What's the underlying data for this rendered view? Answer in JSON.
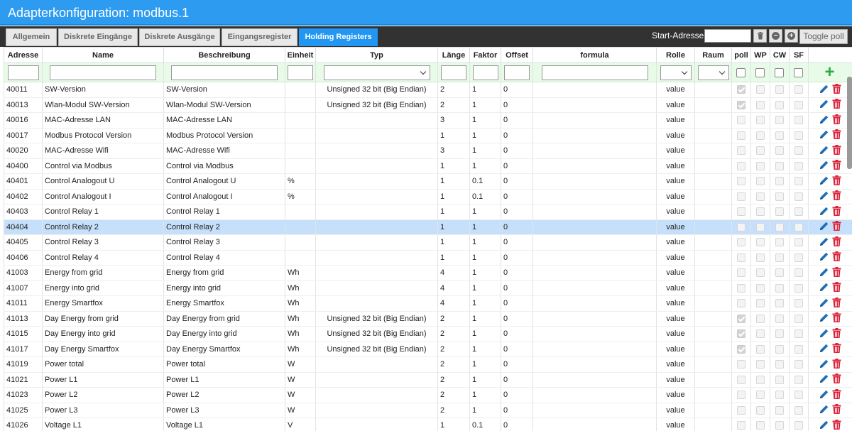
{
  "title": "Adapterkonfiguration: modbus.1",
  "tabs": [
    "Allgemein",
    "Diskrete Eingänge",
    "Diskrete Ausgänge",
    "Eingangsregister",
    "Holding Registers"
  ],
  "toolbar": {
    "start_label": "Start-Adresse:",
    "toggle_label": "Toggle poll"
  },
  "columns": [
    "Adresse",
    "Name",
    "Beschreibung",
    "Einheit",
    "Typ",
    "Länge",
    "Faktor",
    "Offset",
    "formula",
    "Rolle",
    "Raum",
    "poll",
    "WP",
    "CW",
    "SF"
  ],
  "rows": [
    {
      "adresse": "40011",
      "name": "SW-Version",
      "beschreibung": "SW-Version",
      "einheit": "",
      "typ": "Unsigned 32 bit (Big Endian)",
      "laenge": "2",
      "faktor": "1",
      "offset": "0",
      "formula": "",
      "rolle": "value",
      "raum": "",
      "poll": true
    },
    {
      "adresse": "40013",
      "name": "Wlan-Modul SW-Version",
      "beschreibung": "Wlan-Modul SW-Version",
      "einheit": "",
      "typ": "Unsigned 32 bit (Big Endian)",
      "laenge": "2",
      "faktor": "1",
      "offset": "0",
      "formula": "",
      "rolle": "value",
      "raum": "",
      "poll": true
    },
    {
      "adresse": "40016",
      "name": "MAC-Adresse LAN",
      "beschreibung": "MAC-Adresse LAN",
      "einheit": "",
      "typ": "",
      "laenge": "3",
      "faktor": "1",
      "offset": "0",
      "formula": "",
      "rolle": "value",
      "raum": "",
      "poll": false
    },
    {
      "adresse": "40017",
      "name": "Modbus Protocol Version",
      "beschreibung": "Modbus Protocol Version",
      "einheit": "",
      "typ": "",
      "laenge": "1",
      "faktor": "1",
      "offset": "0",
      "formula": "",
      "rolle": "value",
      "raum": "",
      "poll": false
    },
    {
      "adresse": "40020",
      "name": "MAC-Adresse Wifi",
      "beschreibung": "MAC-Adresse Wifi",
      "einheit": "",
      "typ": "",
      "laenge": "3",
      "faktor": "1",
      "offset": "0",
      "formula": "",
      "rolle": "value",
      "raum": "",
      "poll": false
    },
    {
      "adresse": "40400",
      "name": "Control via Modbus",
      "beschreibung": "Control via Modbus",
      "einheit": "",
      "typ": "",
      "laenge": "1",
      "faktor": "1",
      "offset": "0",
      "formula": "",
      "rolle": "value",
      "raum": "",
      "poll": false
    },
    {
      "adresse": "40401",
      "name": "Control Analogout U",
      "beschreibung": "Control Analogout U",
      "einheit": "%",
      "typ": "",
      "laenge": "1",
      "faktor": "0.1",
      "offset": "0",
      "formula": "",
      "rolle": "value",
      "raum": "",
      "poll": false
    },
    {
      "adresse": "40402",
      "name": "Control Analogout I",
      "beschreibung": "Control Analogout I",
      "einheit": "%",
      "typ": "",
      "laenge": "1",
      "faktor": "0.1",
      "offset": "0",
      "formula": "",
      "rolle": "value",
      "raum": "",
      "poll": false
    },
    {
      "adresse": "40403",
      "name": "Control Relay 1",
      "beschreibung": "Control Relay 1",
      "einheit": "",
      "typ": "",
      "laenge": "1",
      "faktor": "1",
      "offset": "0",
      "formula": "",
      "rolle": "value",
      "raum": "",
      "poll": false
    },
    {
      "adresse": "40404",
      "name": "Control Relay 2",
      "beschreibung": "Control Relay 2",
      "einheit": "",
      "typ": "",
      "laenge": "1",
      "faktor": "1",
      "offset": "0",
      "formula": "",
      "rolle": "value",
      "raum": "",
      "poll": false,
      "selected": true
    },
    {
      "adresse": "40405",
      "name": "Control Relay 3",
      "beschreibung": "Control Relay 3",
      "einheit": "",
      "typ": "",
      "laenge": "1",
      "faktor": "1",
      "offset": "0",
      "formula": "",
      "rolle": "value",
      "raum": "",
      "poll": false
    },
    {
      "adresse": "40406",
      "name": "Control Relay 4",
      "beschreibung": "Control Relay 4",
      "einheit": "",
      "typ": "",
      "laenge": "1",
      "faktor": "1",
      "offset": "0",
      "formula": "",
      "rolle": "value",
      "raum": "",
      "poll": false
    },
    {
      "adresse": "41003",
      "name": "Energy from grid",
      "beschreibung": "Energy from grid",
      "einheit": "Wh",
      "typ": "",
      "laenge": "4",
      "faktor": "1",
      "offset": "0",
      "formula": "",
      "rolle": "value",
      "raum": "",
      "poll": false
    },
    {
      "adresse": "41007",
      "name": "Energy into grid",
      "beschreibung": "Energy into grid",
      "einheit": "Wh",
      "typ": "",
      "laenge": "4",
      "faktor": "1",
      "offset": "0",
      "formula": "",
      "rolle": "value",
      "raum": "",
      "poll": false
    },
    {
      "adresse": "41011",
      "name": "Energy Smartfox",
      "beschreibung": "Energy Smartfox",
      "einheit": "Wh",
      "typ": "",
      "laenge": "4",
      "faktor": "1",
      "offset": "0",
      "formula": "",
      "rolle": "value",
      "raum": "",
      "poll": false
    },
    {
      "adresse": "41013",
      "name": "Day Energy from grid",
      "beschreibung": "Day Energy from grid",
      "einheit": "Wh",
      "typ": "Unsigned 32 bit (Big Endian)",
      "laenge": "2",
      "faktor": "1",
      "offset": "0",
      "formula": "",
      "rolle": "value",
      "raum": "",
      "poll": true
    },
    {
      "adresse": "41015",
      "name": "Day Energy into grid",
      "beschreibung": "Day Energy into grid",
      "einheit": "Wh",
      "typ": "Unsigned 32 bit (Big Endian)",
      "laenge": "2",
      "faktor": "1",
      "offset": "0",
      "formula": "",
      "rolle": "value",
      "raum": "",
      "poll": true
    },
    {
      "adresse": "41017",
      "name": "Day Energy Smartfox",
      "beschreibung": "Day Energy Smartfox",
      "einheit": "Wh",
      "typ": "Unsigned 32 bit (Big Endian)",
      "laenge": "2",
      "faktor": "1",
      "offset": "0",
      "formula": "",
      "rolle": "value",
      "raum": "",
      "poll": true
    },
    {
      "adresse": "41019",
      "name": "Power total",
      "beschreibung": "Power total",
      "einheit": "W",
      "typ": "",
      "laenge": "2",
      "faktor": "1",
      "offset": "0",
      "formula": "",
      "rolle": "value",
      "raum": "",
      "poll": false
    },
    {
      "adresse": "41021",
      "name": "Power L1",
      "beschreibung": "Power L1",
      "einheit": "W",
      "typ": "",
      "laenge": "2",
      "faktor": "1",
      "offset": "0",
      "formula": "",
      "rolle": "value",
      "raum": "",
      "poll": false
    },
    {
      "adresse": "41023",
      "name": "Power L2",
      "beschreibung": "Power L2",
      "einheit": "W",
      "typ": "",
      "laenge": "2",
      "faktor": "1",
      "offset": "0",
      "formula": "",
      "rolle": "value",
      "raum": "",
      "poll": false
    },
    {
      "adresse": "41025",
      "name": "Power L3",
      "beschreibung": "Power L3",
      "einheit": "W",
      "typ": "",
      "laenge": "2",
      "faktor": "1",
      "offset": "0",
      "formula": "",
      "rolle": "value",
      "raum": "",
      "poll": false
    },
    {
      "adresse": "41026",
      "name": "Voltage L1",
      "beschreibung": "Voltage L1",
      "einheit": "V",
      "typ": "",
      "laenge": "1",
      "faktor": "0.1",
      "offset": "0",
      "formula": "",
      "rolle": "value",
      "raum": "",
      "poll": false
    }
  ],
  "icons": {
    "trash": "trash-icon",
    "remove": "minus-circle-icon",
    "add_one": "plus-circle-icon",
    "add_row": "plus-icon",
    "edit": "pencil-icon",
    "delete": "trash-icon"
  },
  "colors": {
    "accent": "#2d9bf0",
    "tab_active": "#2196f3",
    "filter_row": "#e8fbe8",
    "selected_row": "#c6e0fb",
    "add_icon": "#2eaa45",
    "edit_icon": "#1f6fb5",
    "delete_icon": "#d9233b"
  }
}
